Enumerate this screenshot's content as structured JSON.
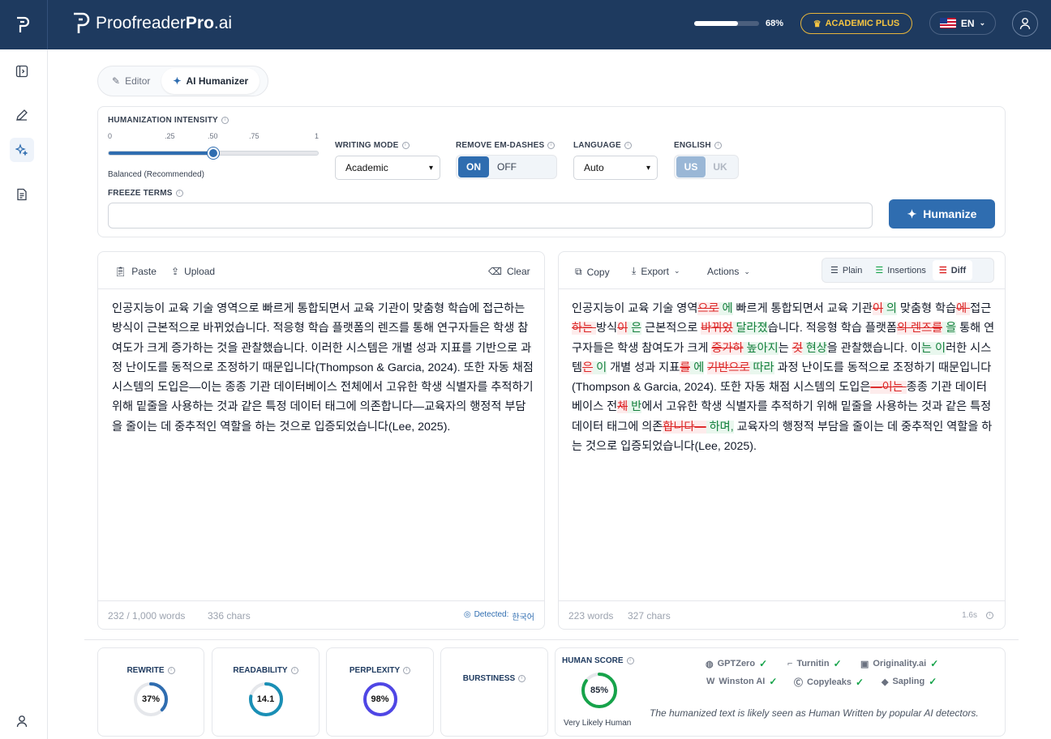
{
  "brand": {
    "name_light": "Proofreader",
    "name_bold": "Pro",
    "name_suffix": ".ai"
  },
  "header": {
    "usage_progress": 68,
    "usage_label": "68%",
    "plan_label": "ACADEMIC PLUS",
    "language_label": "EN"
  },
  "tabs": [
    {
      "label": "Editor"
    },
    {
      "label": "AI Humanizer"
    }
  ],
  "settings": {
    "intensity_label": "HUMANIZATION INTENSITY",
    "intensity_ticks": [
      "0",
      ".25",
      ".50",
      ".75",
      "1"
    ],
    "intensity_value": 0.5,
    "intensity_caption": "Balanced (Recommended)",
    "writing_mode_label": "WRITING MODE",
    "writing_mode_value": "Academic",
    "em_dash_label": "REMOVE EM-DASHES",
    "em_dash_on": "ON",
    "em_dash_off": "OFF",
    "language_label": "LANGUAGE",
    "language_value": "Auto",
    "english_label": "ENGLISH",
    "english_us": "US",
    "english_uk": "UK",
    "freeze_label": "FREEZE TERMS",
    "freeze_value": "",
    "humanize_button": "Humanize"
  },
  "input_panel": {
    "paste": "Paste",
    "upload": "Upload",
    "clear": "Clear",
    "text": "인공지능이 교육 기술 영역으로 빠르게 통합되면서 교육 기관이 맞춤형 학습에 접근하는 방식이 근본적으로 바뀌었습니다. 적응형 학습 플랫폼의 렌즈를 통해 연구자들은 학생 참여도가 크게 증가하는 것을 관찰했습니다. 이러한 시스템은 개별 성과 지표를 기반으로 과정 난이도를 동적으로 조정하기 때문입니다(Thompson & Garcia, 2024). 또한 자동 채점 시스템의 도입은—이는 종종 기관 데이터베이스 전체에서 고유한 학생 식별자를 추적하기 위해 밑줄을 사용하는 것과 같은 특정 데이터 태그에 의존합니다—교육자의 행정적 부담을 줄이는 데 중추적인 역할을 하는 것으로 입증되었습니다(Lee, 2025).",
    "word_count": "232 / 1,000 words",
    "char_count": "336 chars",
    "detected_prefix": "Detected:",
    "detected_lang": "한국어"
  },
  "output_panel": {
    "copy": "Copy",
    "export": "Export",
    "actions": "Actions",
    "view_plain": "Plain",
    "view_insertions": "Insertions",
    "view_diff": "Diff",
    "diff": [
      {
        "t": "인공지능이 교육 기술 영역",
        "k": "n"
      },
      {
        "t": "으로",
        "k": "d"
      },
      {
        "t": " 에",
        "k": "i"
      },
      {
        "t": " 빠르게 통합되면서 교육 기관",
        "k": "n"
      },
      {
        "t": "이",
        "k": "d"
      },
      {
        "t": " 의",
        "k": "i"
      },
      {
        "t": " 맞춤형 학습",
        "k": "n"
      },
      {
        "t": "에 ",
        "k": "d"
      },
      {
        "t": "접근",
        "k": "n"
      },
      {
        "t": "하는 ",
        "k": "d"
      },
      {
        "t": "방식",
        "k": "n"
      },
      {
        "t": "이",
        "k": "d"
      },
      {
        "t": " 은",
        "k": "i"
      },
      {
        "t": " 근본적으로 ",
        "k": "n"
      },
      {
        "t": "바뀌었",
        "k": "d"
      },
      {
        "t": " 달라졌",
        "k": "i"
      },
      {
        "t": "습니다. 적응형 학습 플랫폼",
        "k": "n"
      },
      {
        "t": "의 렌즈를",
        "k": "d"
      },
      {
        "t": " 을",
        "k": "i"
      },
      {
        "t": " 통해 연구자들은 학생 참여도가 크게 ",
        "k": "n"
      },
      {
        "t": "증가하",
        "k": "d"
      },
      {
        "t": " 높아지",
        "k": "i"
      },
      {
        "t": "는 ",
        "k": "n"
      },
      {
        "t": "것",
        "k": "d"
      },
      {
        "t": " 현상",
        "k": "i"
      },
      {
        "t": "을 관찰했습니다. 이",
        "k": "n"
      },
      {
        "t": "는 이",
        "k": "i"
      },
      {
        "t": "러한 시스템",
        "k": "n"
      },
      {
        "t": "은",
        "k": "d"
      },
      {
        "t": " 이",
        "k": "i"
      },
      {
        "t": " 개별 성과 지표",
        "k": "n"
      },
      {
        "t": "를",
        "k": "d"
      },
      {
        "t": " 에",
        "k": "i"
      },
      {
        "t": " ",
        "k": "n"
      },
      {
        "t": "기반으로",
        "k": "d"
      },
      {
        "t": " 따라",
        "k": "i"
      },
      {
        "t": " 과정 난이도를 동적으로 조정하기 때문입니다(Thompson & Garcia, 2024). 또한 자동 채점 시스템의 도입은",
        "k": "n"
      },
      {
        "t": "—이는 ",
        "k": "d"
      },
      {
        "t": "종종 기관 데이터베이스 전",
        "k": "n"
      },
      {
        "t": "체",
        "k": "d"
      },
      {
        "t": " 반",
        "k": "i"
      },
      {
        "t": "에서 고유한 학생 식별자를 추적하기 위해 밑줄을 사용하는 것과 같은 특정 데이터 태그에 의존",
        "k": "n"
      },
      {
        "t": "합니다—",
        "k": "d"
      },
      {
        "t": " 하며,",
        "k": "i"
      },
      {
        "t": " 교육자의 행정적 부담을 줄이는 데 중추적인 역할을 하는 것으로 입증되었습니다(Lee, 2025).",
        "k": "n"
      }
    ],
    "word_count": "223 words",
    "char_count": "327 chars",
    "time": "1.6s"
  },
  "metrics": {
    "rewrite": {
      "label": "REWRITE",
      "value": 37,
      "display": "37%",
      "color": "#2f6db0"
    },
    "readability": {
      "label": "READABILITY",
      "value": 78,
      "display": "14.1",
      "color": "#1a8fb5"
    },
    "perplexity": {
      "label": "PERPLEXITY",
      "value": 98,
      "display": "98%",
      "color": "#4f46e5"
    },
    "burstiness": {
      "label": "BURSTINESS"
    },
    "human_score": {
      "label": "HUMAN SCORE",
      "value": 85,
      "display": "85%",
      "caption": "Very Likely Human",
      "color": "#16a34a"
    }
  },
  "detectors": [
    "GPTZero",
    "Turnitin",
    "Originality.ai",
    "Winston AI",
    "Copyleaks",
    "Sapling"
  ],
  "detector_note": "The humanized text is likely seen as Human Written by popular AI detectors."
}
